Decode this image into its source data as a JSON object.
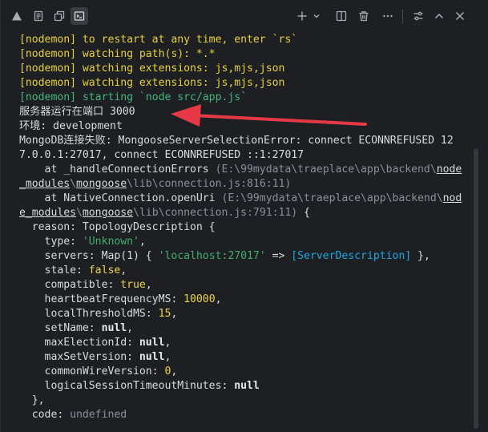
{
  "toolbar": {
    "left_icons": [
      {
        "name": "warning-icon"
      },
      {
        "name": "output-icon"
      },
      {
        "name": "debug-console-icon"
      },
      {
        "name": "terminal-icon",
        "active": true
      }
    ],
    "right_icons": [
      {
        "name": "add-terminal-icon"
      },
      {
        "name": "chevron-down-icon"
      },
      {
        "name": "split-terminal-icon"
      },
      {
        "name": "trash-icon"
      },
      {
        "name": "more-icon"
      },
      {
        "name": "settings-sliders-icon"
      },
      {
        "name": "maximize-panel-icon"
      },
      {
        "name": "close-panel-icon"
      }
    ]
  },
  "terminal": {
    "lines": [
      [
        {
          "t": "[nodemon] to restart at any time, enter `rs`",
          "c": "yellow"
        }
      ],
      [
        {
          "t": "[nodemon] watching path(s): *.*",
          "c": "yellow"
        }
      ],
      [
        {
          "t": "[nodemon] watching extensions: js,mjs,json",
          "c": "yellow"
        }
      ],
      [
        {
          "t": "[nodemon] watching extensions: js,mjs,json",
          "c": "yellow"
        }
      ],
      [
        {
          "t": "[nodemon] starting `node src/app.js`",
          "c": "green"
        }
      ],
      [
        {
          "t": "服务器运行在端口 3000",
          "c": "text"
        }
      ],
      [
        {
          "t": "环境: development",
          "c": "text"
        }
      ],
      [
        {
          "t": "MongoDB连接失败: MongooseServerSelectionError: connect ECONNREFUSED 12",
          "c": "text"
        }
      ],
      [
        {
          "t": "7.0.0.1:27017, connect ECONNREFUSED ::1:27017",
          "c": "text"
        }
      ],
      [
        {
          "t": "    at _handleConnectionErrors ",
          "c": "text"
        },
        {
          "t": "(E:\\99mydata\\traeplace\\app\\backend\\",
          "c": "grey"
        },
        {
          "t": "node",
          "c": "under"
        }
      ],
      [
        {
          "t": "_modules",
          "c": "under"
        },
        {
          "t": "\\",
          "c": "grey"
        },
        {
          "t": "mongoose",
          "c": "under"
        },
        {
          "t": "\\lib\\connection.js:816:11)",
          "c": "grey"
        }
      ],
      [
        {
          "t": "    at NativeConnection.openUri ",
          "c": "text"
        },
        {
          "t": "(E:\\99mydata\\traeplace\\app\\backend\\",
          "c": "grey"
        },
        {
          "t": "nod",
          "c": "under"
        }
      ],
      [
        {
          "t": "e_modules",
          "c": "under"
        },
        {
          "t": "\\",
          "c": "grey"
        },
        {
          "t": "mongoose",
          "c": "under"
        },
        {
          "t": "\\lib\\connection.js:791:11)",
          "c": "grey"
        },
        {
          "t": " {",
          "c": "text"
        }
      ],
      [
        {
          "t": "  reason: TopologyDescription {",
          "c": "text"
        }
      ],
      [
        {
          "t": "    type: ",
          "c": "text"
        },
        {
          "t": "'Unknown'",
          "c": "str"
        },
        {
          "t": ",",
          "c": "text"
        }
      ],
      [
        {
          "t": "    servers: Map(1) { ",
          "c": "text"
        },
        {
          "t": "'localhost:27017'",
          "c": "str"
        },
        {
          "t": " => ",
          "c": "text"
        },
        {
          "t": "[ServerDescription]",
          "c": "cyan"
        },
        {
          "t": " },",
          "c": "text"
        }
      ],
      [
        {
          "t": "    stale: ",
          "c": "text"
        },
        {
          "t": "false",
          "c": "yel2"
        },
        {
          "t": ",",
          "c": "text"
        }
      ],
      [
        {
          "t": "    compatible: ",
          "c": "text"
        },
        {
          "t": "true",
          "c": "yel2"
        },
        {
          "t": ",",
          "c": "text"
        }
      ],
      [
        {
          "t": "    heartbeatFrequencyMS: ",
          "c": "text"
        },
        {
          "t": "10000",
          "c": "yel2"
        },
        {
          "t": ",",
          "c": "text"
        }
      ],
      [
        {
          "t": "    localThresholdMS: ",
          "c": "text"
        },
        {
          "t": "15",
          "c": "yel2"
        },
        {
          "t": ",",
          "c": "text"
        }
      ],
      [
        {
          "t": "    setName: ",
          "c": "text"
        },
        {
          "t": "null",
          "c": "bold"
        },
        {
          "t": ",",
          "c": "text"
        }
      ],
      [
        {
          "t": "    maxElectionId: ",
          "c": "text"
        },
        {
          "t": "null",
          "c": "bold"
        },
        {
          "t": ",",
          "c": "text"
        }
      ],
      [
        {
          "t": "    maxSetVersion: ",
          "c": "text"
        },
        {
          "t": "null",
          "c": "bold"
        },
        {
          "t": ",",
          "c": "text"
        }
      ],
      [
        {
          "t": "    commonWireVersion: ",
          "c": "text"
        },
        {
          "t": "0",
          "c": "yel2"
        },
        {
          "t": ",",
          "c": "text"
        }
      ],
      [
        {
          "t": "    logicalSessionTimeoutMinutes: ",
          "c": "text"
        },
        {
          "t": "null",
          "c": "bold"
        }
      ],
      [
        {
          "t": "  },",
          "c": "text"
        }
      ],
      [
        {
          "t": "  code: ",
          "c": "text"
        },
        {
          "t": "undefined",
          "c": "grey"
        }
      ]
    ]
  },
  "colors": {
    "background": "#1e1f22",
    "nodemon_yellow": "#e5d13d",
    "nodemon_green": "#43b581",
    "annotation_arrow": "#e53945"
  }
}
